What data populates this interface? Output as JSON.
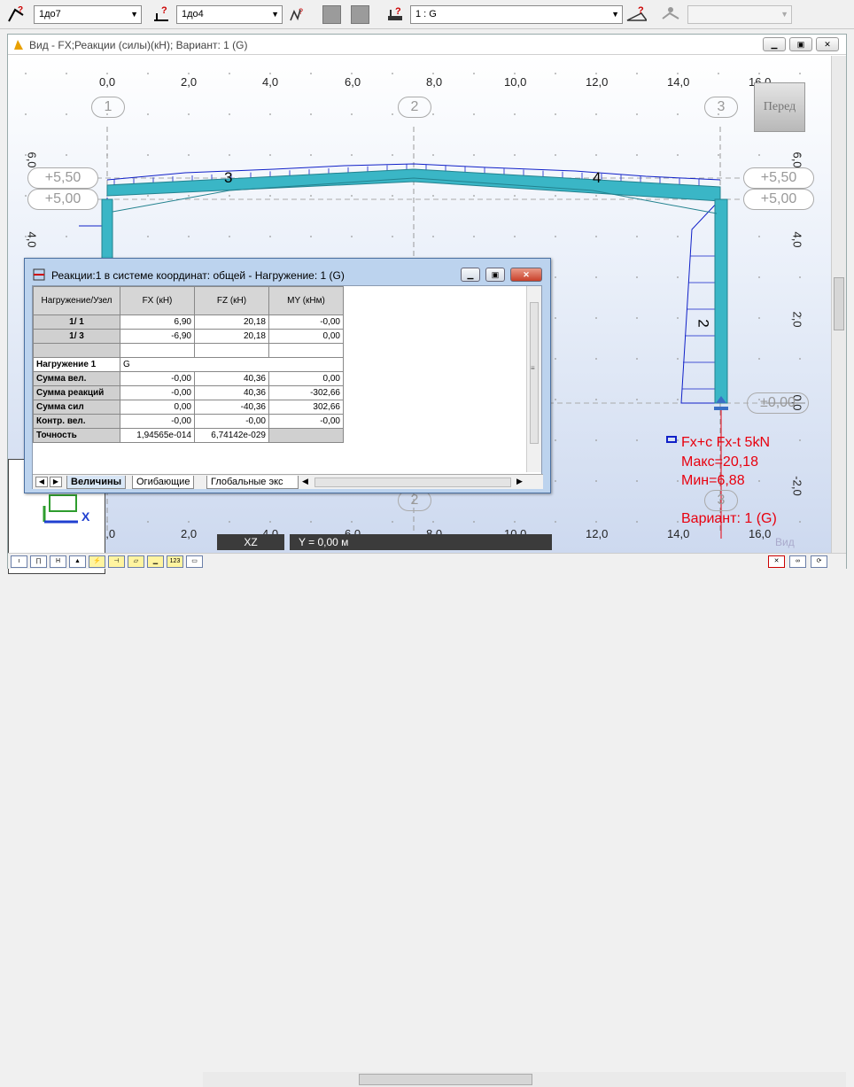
{
  "toolbar": {
    "combo1": "1до7",
    "combo2": "1до4",
    "combo3": "1 : G",
    "combo4": ""
  },
  "view": {
    "title": "Вид - FX;Реакции (силы)(кН); Вариант: 1 (G)",
    "view_cube": "Перед",
    "x_ticks": [
      "0,0",
      "2,0",
      "4,0",
      "6,0",
      "8,0",
      "10,0",
      "12,0",
      "14,0",
      "16,0"
    ],
    "y_ticks": [
      "6,0",
      "4,0",
      "2,0",
      "0,0",
      "-2,0"
    ],
    "axes": [
      "1",
      "2",
      "3"
    ],
    "levels": [
      "+5,50",
      "+5,00",
      "±0,00"
    ],
    "members": [
      "3",
      "4",
      "2"
    ],
    "axis_x": "X",
    "status_xz": "XZ",
    "status_y": "Y = 0,00 м",
    "status_faded": "Вид"
  },
  "legend": {
    "line1": "Fx+c Fx-t  5kN",
    "line2": "Макс=20,18",
    "line3": "Мин=6,88",
    "line4": "Вариант: 1 (G)"
  },
  "dialog": {
    "title": "Реакции:1 в системе координат: общей - Нагружение: 1 (G)",
    "headers": [
      "Нагружение/Узел",
      "FX (кН)",
      "FZ (кН)",
      "MY (кНм)"
    ],
    "rows": [
      [
        "1/      1",
        "6,90",
        "20,18",
        "-0,00"
      ],
      [
        "1/      3",
        "-6,90",
        "20,18",
        "0,00"
      ]
    ],
    "load_label": "Нагружение 1",
    "load_value": "G",
    "sums": [
      [
        "Сумма вел.",
        "-0,00",
        "40,36",
        "0,00"
      ],
      [
        "Сумма реакций",
        "-0,00",
        "40,36",
        "-302,66"
      ],
      [
        "Сумма сил",
        "0,00",
        "-40,36",
        "302,66"
      ],
      [
        "Контр. вел.",
        "-0,00",
        "-0,00",
        "-0,00"
      ],
      [
        "Точность",
        "1,94565e-014",
        "6,74142e-029",
        ""
      ]
    ],
    "tabs": [
      "Величины",
      "Огибающие",
      "Глобальные экс"
    ]
  },
  "colors": {
    "member": "#3ab6c6",
    "member_dark": "#23828f",
    "reaction": "#e8000e",
    "diagram": "#1020c8"
  }
}
